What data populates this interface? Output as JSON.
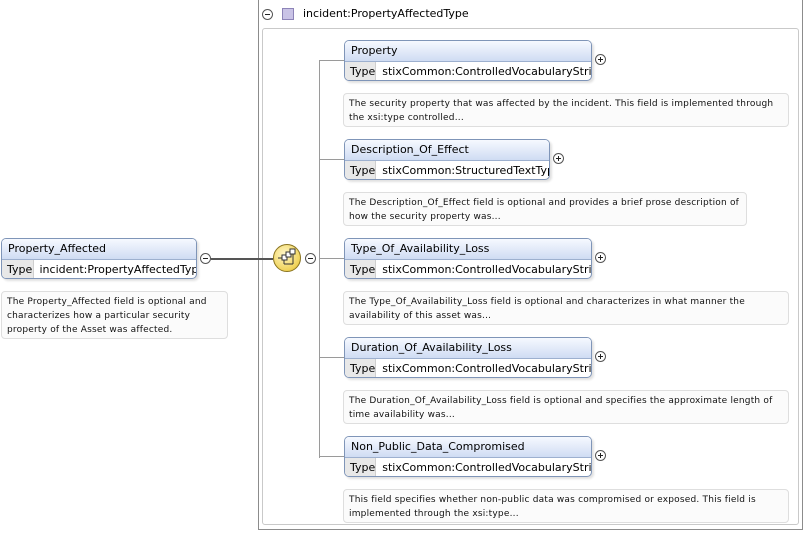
{
  "root": {
    "name": "Property_Affected",
    "type_label": "Type",
    "type_value": "incident:PropertyAffectedType",
    "doc": "The Property_Affected field is optional and characterizes how a particular security property of the Asset was affected."
  },
  "group": {
    "title": "incident:PropertyAffectedType"
  },
  "elements": [
    {
      "name": "Property",
      "type_label": "Type",
      "type_value": "stixCommon:ControlledVocabularyStrin ...",
      "doc": "The security property that was affected by the incident. This field is implemented through the xsi:type controlled..."
    },
    {
      "name": "Description_Of_Effect",
      "type_label": "Type",
      "type_value": "stixCommon:StructuredTextType",
      "doc": "The Description_Of_Effect field is optional and provides a brief prose description of how the security property was..."
    },
    {
      "name": "Type_Of_Availability_Loss",
      "type_label": "Type",
      "type_value": "stixCommon:ControlledVocabularyStrin ...",
      "doc": "The Type_Of_Availability_Loss field is optional and characterizes in what manner the availability of this asset was..."
    },
    {
      "name": "Duration_Of_Availability_Loss",
      "type_label": "Type",
      "type_value": "stixCommon:ControlledVocabularyStrin ...",
      "doc": "The Duration_Of_Availability_Loss field is optional and specifies the approximate length of time availability was..."
    },
    {
      "name": "Non_Public_Data_Compromised",
      "type_label": "Type",
      "type_value": "stixCommon:ControlledVocabularyStrin ...",
      "doc": "This field specifies whether non-public data was compromised or exposed. This field is implemented through the xsi:type..."
    }
  ],
  "icons": {
    "collapse": "collapse-icon",
    "expand": "expand-icon",
    "sequence": "sequence-compositor-icon",
    "complex_type": "complex-type-icon"
  },
  "colors": {
    "header_gradient_top": "#f6f9ff",
    "header_gradient_bottom": "#cfdcf3",
    "border": "#7f95b8",
    "type_square": "#c9c3e6",
    "sequence": "#f0d35a"
  }
}
